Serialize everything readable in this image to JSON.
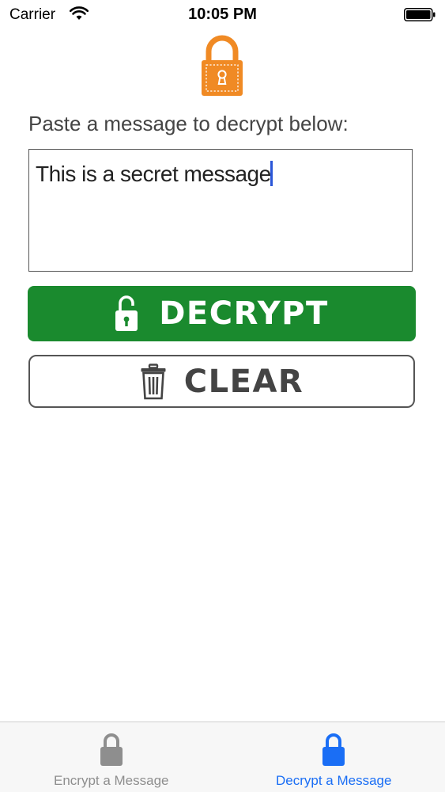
{
  "status_bar": {
    "carrier": "Carrier",
    "time": "10:05 PM"
  },
  "header": {
    "logo_icon": "padlock-icon",
    "logo_color": "#f08a24"
  },
  "main": {
    "prompt": "Paste a message to decrypt below:",
    "message_text": "This is a secret message",
    "decrypt_button": {
      "label": "DECRYPT",
      "icon": "unlock-icon",
      "color": "#1a8a2e"
    },
    "clear_button": {
      "label": "CLEAR",
      "icon": "trash-icon"
    }
  },
  "tab_bar": {
    "tabs": [
      {
        "label": "Encrypt a Message",
        "icon": "lock-icon",
        "active": false,
        "color": "#8e8e8e"
      },
      {
        "label": "Decrypt a Message",
        "icon": "lock-icon",
        "active": true,
        "color": "#1a6ef5"
      }
    ]
  }
}
